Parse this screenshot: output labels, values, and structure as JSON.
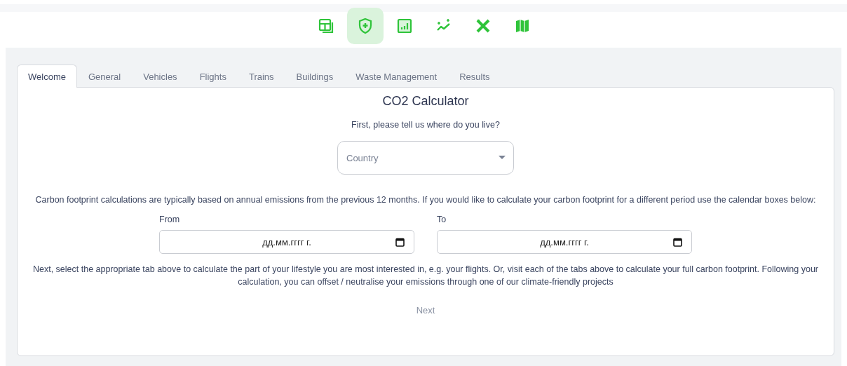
{
  "toolbar": [
    {
      "selected": false
    },
    {
      "selected": true
    },
    {
      "selected": false
    },
    {
      "selected": false
    },
    {
      "selected": false
    },
    {
      "selected": false
    }
  ],
  "tabs": [
    {
      "label": "Welcome",
      "selected": true
    },
    {
      "label": "General",
      "selected": false
    },
    {
      "label": "Vehicles",
      "selected": false
    },
    {
      "label": "Flights",
      "selected": false
    },
    {
      "label": "Trains",
      "selected": false
    },
    {
      "label": "Buildings",
      "selected": false
    },
    {
      "label": "Waste Management",
      "selected": false
    },
    {
      "label": "Results",
      "selected": false
    }
  ],
  "title": "CO2 Calculator",
  "question": "First, please tell us where do you live?",
  "country_field": {
    "placeholder": "Country"
  },
  "period_text": "Carbon footprint calculations are typically based on annual emissions from the previous 12 months. If you would like to calculate your carbon footprint for a different period use the calendar boxes below:",
  "dates": [
    {
      "label": "From",
      "placeholder": "дд.мм.гггг г."
    },
    {
      "label": "To",
      "placeholder": "дд.мм.гггг г."
    }
  ],
  "next_text": "Next, select the appropriate tab above to calculate the part of your lifestyle you are most interested in, e.g. your flights. Or, visit each of the tabs above to calculate your full carbon footprint. Following your calculation, you can offset / neutralise your emissions through one of our climate-friendly projects",
  "next_button": "Next"
}
